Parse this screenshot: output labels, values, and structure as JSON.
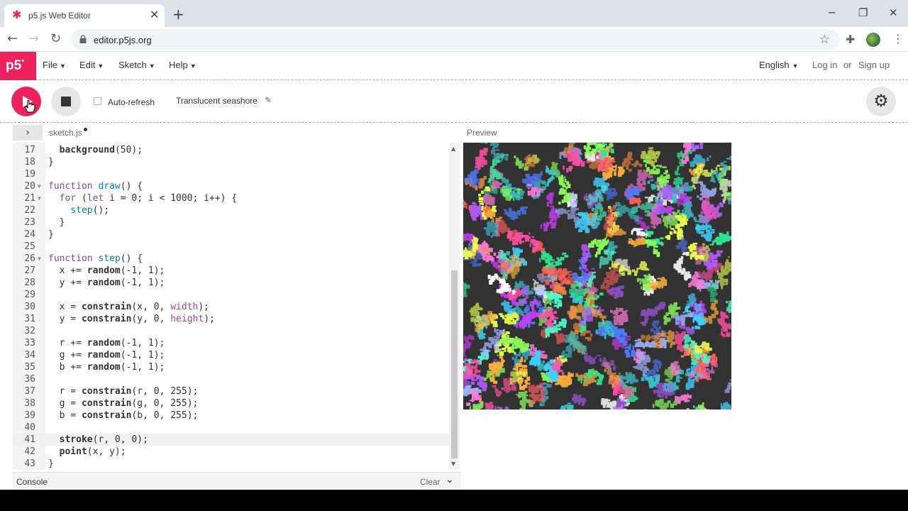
{
  "browser": {
    "tab_title": "p5.js Web Editor",
    "url": "editor.p5js.org"
  },
  "nav": {
    "logo": "p5",
    "menus": [
      "File",
      "Edit",
      "Sketch",
      "Help"
    ],
    "language": "English",
    "login": "Log in",
    "or": "or",
    "signup": "Sign up"
  },
  "toolbar": {
    "auto_refresh_label": "Auto-refresh",
    "auto_refresh_checked": false,
    "sketch_name": "Translucent seashore"
  },
  "editor": {
    "file_name": "sketch.js",
    "preview_label": "Preview",
    "current_line": 41,
    "lines": [
      {
        "n": "17",
        "text": "  background(50);"
      },
      {
        "n": "18",
        "text": "}"
      },
      {
        "n": "19",
        "text": ""
      },
      {
        "n": "20",
        "text": "function draw() {",
        "fold": true
      },
      {
        "n": "21",
        "text": "  for (let i = 0; i < 1000; i++) {",
        "fold": true
      },
      {
        "n": "22",
        "text": "    step();"
      },
      {
        "n": "23",
        "text": "  }"
      },
      {
        "n": "24",
        "text": "}"
      },
      {
        "n": "25",
        "text": ""
      },
      {
        "n": "26",
        "text": "function step() {",
        "fold": true
      },
      {
        "n": "27",
        "text": "  x += random(-1, 1);"
      },
      {
        "n": "28",
        "text": "  y += random(-1, 1);"
      },
      {
        "n": "29",
        "text": ""
      },
      {
        "n": "30",
        "text": "  x = constrain(x, 0, width);"
      },
      {
        "n": "31",
        "text": "  y = constrain(y, 0, height);"
      },
      {
        "n": "32",
        "text": ""
      },
      {
        "n": "33",
        "text": "  r += random(-1, 1);"
      },
      {
        "n": "34",
        "text": "  g += random(-1, 1);"
      },
      {
        "n": "35",
        "text": "  b += random(-1, 1);"
      },
      {
        "n": "36",
        "text": ""
      },
      {
        "n": "37",
        "text": "  r = constrain(r, 0, 255);"
      },
      {
        "n": "38",
        "text": "  g = constrain(g, 0, 255);"
      },
      {
        "n": "39",
        "text": "  b = constrain(b, 0, 255);"
      },
      {
        "n": "40",
        "text": ""
      },
      {
        "n": "41",
        "text": "  stroke(r, 0, 0);"
      },
      {
        "n": "42",
        "text": "  point(x, y);"
      },
      {
        "n": "43",
        "text": "}"
      }
    ]
  },
  "console": {
    "label": "Console",
    "clear": "Clear"
  },
  "colors": {
    "accent": "#ed225d",
    "preview_bg": "#323232"
  },
  "icons": {
    "favicon": "p5-star-icon",
    "play": "play-icon",
    "stop": "stop-icon",
    "settings": "gear-icon"
  }
}
